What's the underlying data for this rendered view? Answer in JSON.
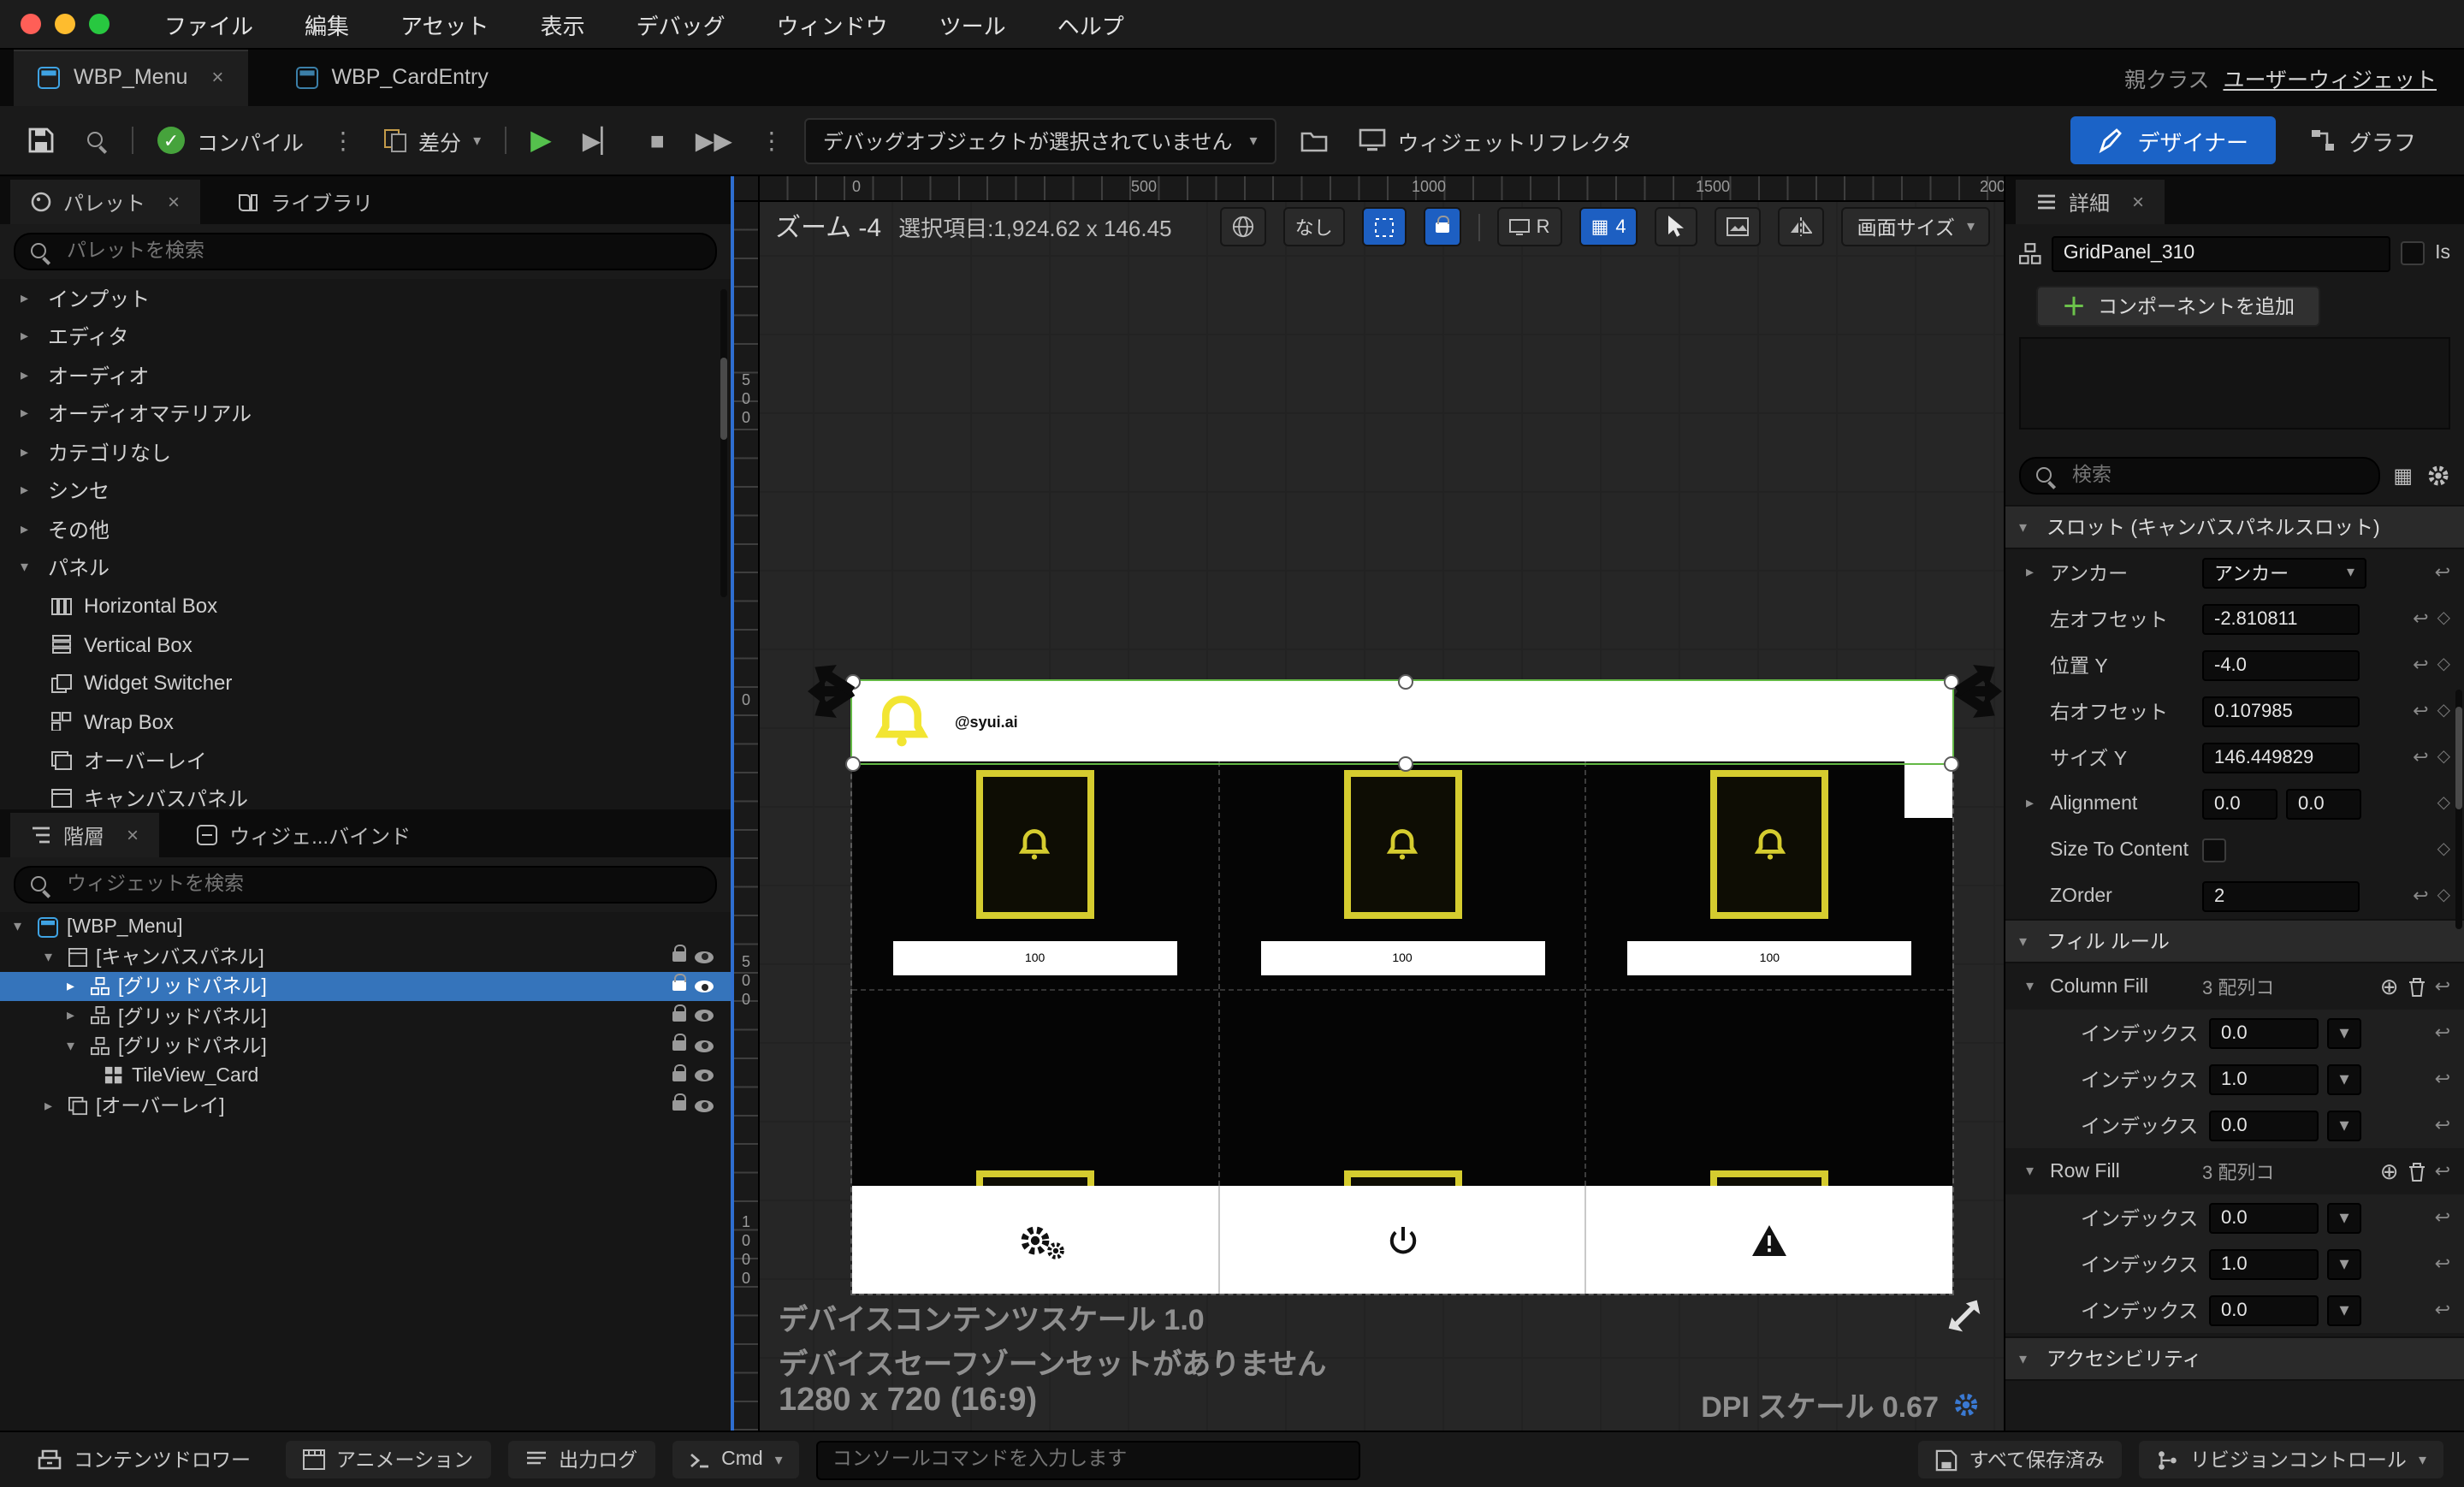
{
  "colors": {
    "accent_blue": "#1b63c7",
    "selection_blue": "#3574bb",
    "card_yellow": "#d5cc2f",
    "logo_yellow": "#f2e532",
    "compile_green": "#46a33c",
    "play_green": "#55c14d",
    "selection_outline_green": "#63b845",
    "viewport_bg": "#262626",
    "panel_bg": "#161616"
  },
  "menubar": {
    "items": [
      "ファイル",
      "編集",
      "アセット",
      "表示",
      "デバッグ",
      "ウィンドウ",
      "ツール",
      "ヘルプ"
    ]
  },
  "tabbar": {
    "tabs": [
      {
        "label": "WBP_Menu"
      },
      {
        "label": "WBP_CardEntry"
      }
    ],
    "close_glyph": "×",
    "parent_class_label": "親クラス",
    "parent_class_value": "ユーザーウィジェット"
  },
  "toolbar": {
    "compile_label": "コンパイル",
    "diff_label": "差分",
    "debug_dropdown": "デバッグオブジェクトが選択されていません",
    "widget_reflector": "ウィジェットリフレクタ",
    "designer_label": "デザイナー",
    "graph_label": "グラフ"
  },
  "palette": {
    "tab_label": "パレット",
    "library_tab_label": "ライブラリ",
    "search_placeholder": "パレットを検索",
    "categories": [
      "インプット",
      "エディタ",
      "オーディオ",
      "オーディオマテリアル",
      "カテゴリなし",
      "シンセ",
      "その他",
      "パネル"
    ],
    "panel_items": [
      "Horizontal Box",
      "Vertical Box",
      "Widget Switcher",
      "Wrap Box",
      "オーバーレイ",
      "キャンバスパネル"
    ]
  },
  "hierarchy": {
    "tab_label": "階層",
    "bind_tab_label": "ウィジェ...バインド",
    "search_placeholder": "ウィジェットを検索",
    "items": [
      {
        "label": "[WBP_Menu]"
      },
      {
        "label": "[キャンバスパネル]"
      },
      {
        "label": "[グリッドパネル]"
      },
      {
        "label": "[グリッドパネル]"
      },
      {
        "label": "[グリッドパネル]"
      },
      {
        "label": "TileView_Card"
      },
      {
        "label": "[オーバーレイ]"
      }
    ]
  },
  "viewport": {
    "zoom_label": "ズーム -4",
    "selection_label": "選択項目:1,924.62 x 146.45",
    "none_button": "なし",
    "r_button": "R",
    "grid_button": "4",
    "screen_size_button": "画面サイズ",
    "h_ruler": [
      "0",
      "500",
      "1000",
      "1500",
      "200"
    ],
    "v_ruler": [
      "500",
      "0",
      "500",
      "1000"
    ],
    "preview": {
      "username": "@syui.ai",
      "card_value": "100"
    },
    "overlay": {
      "content_scale": "デバイスコンテンツスケール 1.0",
      "safe_zone": "デバイスセーフゾーンセットがありません",
      "resolution": "1280 x 720 (16:9)",
      "dpi_scale": "DPI スケール 0.67"
    }
  },
  "details": {
    "tab_label": "詳細",
    "object_name": "GridPanel_310",
    "is_label": "Is",
    "add_component_label": "コンポーネントを追加",
    "search_placeholder": "検索",
    "slot_section": "スロット (キャンバスパネルスロット)",
    "anchor_label": "アンカー",
    "anchor_value": "アンカー",
    "offset_left_label": "左オフセット",
    "offset_left_value": "-2.810811",
    "pos_y_label": "位置 Y",
    "pos_y_value": "-4.0",
    "offset_right_label": "右オフセット",
    "offset_right_value": "0.107985",
    "size_y_label": "サイズ Y",
    "size_y_value": "146.449829",
    "alignment_label": "Alignment",
    "alignment_x": "0.0",
    "alignment_y": "0.0",
    "size_to_content_label": "Size To Content",
    "zorder_label": "ZOrder",
    "zorder_value": "2",
    "fill_section": "フィル ルール",
    "column_fill_label": "Column Fill",
    "column_fill_count": "3 配列コ",
    "row_fill_label": "Row Fill",
    "row_fill_count": "3 配列コ",
    "index_label": "インデックス",
    "column_fill_values": [
      "0.0",
      "1.0",
      "0.0"
    ],
    "row_fill_values": [
      "0.0",
      "1.0",
      "0.0"
    ],
    "accessibility_section": "アクセシビリティ"
  },
  "statusbar": {
    "content_drawer": "コンテンツドロワー",
    "animation": "アニメーション",
    "output_log": "出力ログ",
    "cmd": "Cmd",
    "console_placeholder": "コンソールコマンドを入力します",
    "saved": "すべて保存済み",
    "revision_control": "リビジョンコントロール"
  }
}
